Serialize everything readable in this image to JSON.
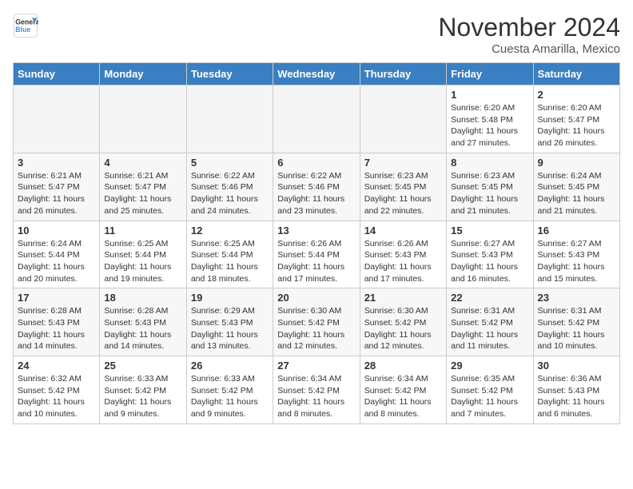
{
  "header": {
    "logo_general": "General",
    "logo_blue": "Blue",
    "month_title": "November 2024",
    "location": "Cuesta Amarilla, Mexico"
  },
  "weekdays": [
    "Sunday",
    "Monday",
    "Tuesday",
    "Wednesday",
    "Thursday",
    "Friday",
    "Saturday"
  ],
  "weeks": [
    [
      {
        "day": "",
        "info": ""
      },
      {
        "day": "",
        "info": ""
      },
      {
        "day": "",
        "info": ""
      },
      {
        "day": "",
        "info": ""
      },
      {
        "day": "",
        "info": ""
      },
      {
        "day": "1",
        "info": "Sunrise: 6:20 AM\nSunset: 5:48 PM\nDaylight: 11 hours and 27 minutes."
      },
      {
        "day": "2",
        "info": "Sunrise: 6:20 AM\nSunset: 5:47 PM\nDaylight: 11 hours and 26 minutes."
      }
    ],
    [
      {
        "day": "3",
        "info": "Sunrise: 6:21 AM\nSunset: 5:47 PM\nDaylight: 11 hours and 26 minutes."
      },
      {
        "day": "4",
        "info": "Sunrise: 6:21 AM\nSunset: 5:47 PM\nDaylight: 11 hours and 25 minutes."
      },
      {
        "day": "5",
        "info": "Sunrise: 6:22 AM\nSunset: 5:46 PM\nDaylight: 11 hours and 24 minutes."
      },
      {
        "day": "6",
        "info": "Sunrise: 6:22 AM\nSunset: 5:46 PM\nDaylight: 11 hours and 23 minutes."
      },
      {
        "day": "7",
        "info": "Sunrise: 6:23 AM\nSunset: 5:45 PM\nDaylight: 11 hours and 22 minutes."
      },
      {
        "day": "8",
        "info": "Sunrise: 6:23 AM\nSunset: 5:45 PM\nDaylight: 11 hours and 21 minutes."
      },
      {
        "day": "9",
        "info": "Sunrise: 6:24 AM\nSunset: 5:45 PM\nDaylight: 11 hours and 21 minutes."
      }
    ],
    [
      {
        "day": "10",
        "info": "Sunrise: 6:24 AM\nSunset: 5:44 PM\nDaylight: 11 hours and 20 minutes."
      },
      {
        "day": "11",
        "info": "Sunrise: 6:25 AM\nSunset: 5:44 PM\nDaylight: 11 hours and 19 minutes."
      },
      {
        "day": "12",
        "info": "Sunrise: 6:25 AM\nSunset: 5:44 PM\nDaylight: 11 hours and 18 minutes."
      },
      {
        "day": "13",
        "info": "Sunrise: 6:26 AM\nSunset: 5:44 PM\nDaylight: 11 hours and 17 minutes."
      },
      {
        "day": "14",
        "info": "Sunrise: 6:26 AM\nSunset: 5:43 PM\nDaylight: 11 hours and 17 minutes."
      },
      {
        "day": "15",
        "info": "Sunrise: 6:27 AM\nSunset: 5:43 PM\nDaylight: 11 hours and 16 minutes."
      },
      {
        "day": "16",
        "info": "Sunrise: 6:27 AM\nSunset: 5:43 PM\nDaylight: 11 hours and 15 minutes."
      }
    ],
    [
      {
        "day": "17",
        "info": "Sunrise: 6:28 AM\nSunset: 5:43 PM\nDaylight: 11 hours and 14 minutes."
      },
      {
        "day": "18",
        "info": "Sunrise: 6:28 AM\nSunset: 5:43 PM\nDaylight: 11 hours and 14 minutes."
      },
      {
        "day": "19",
        "info": "Sunrise: 6:29 AM\nSunset: 5:43 PM\nDaylight: 11 hours and 13 minutes."
      },
      {
        "day": "20",
        "info": "Sunrise: 6:30 AM\nSunset: 5:42 PM\nDaylight: 11 hours and 12 minutes."
      },
      {
        "day": "21",
        "info": "Sunrise: 6:30 AM\nSunset: 5:42 PM\nDaylight: 11 hours and 12 minutes."
      },
      {
        "day": "22",
        "info": "Sunrise: 6:31 AM\nSunset: 5:42 PM\nDaylight: 11 hours and 11 minutes."
      },
      {
        "day": "23",
        "info": "Sunrise: 6:31 AM\nSunset: 5:42 PM\nDaylight: 11 hours and 10 minutes."
      }
    ],
    [
      {
        "day": "24",
        "info": "Sunrise: 6:32 AM\nSunset: 5:42 PM\nDaylight: 11 hours and 10 minutes."
      },
      {
        "day": "25",
        "info": "Sunrise: 6:33 AM\nSunset: 5:42 PM\nDaylight: 11 hours and 9 minutes."
      },
      {
        "day": "26",
        "info": "Sunrise: 6:33 AM\nSunset: 5:42 PM\nDaylight: 11 hours and 9 minutes."
      },
      {
        "day": "27",
        "info": "Sunrise: 6:34 AM\nSunset: 5:42 PM\nDaylight: 11 hours and 8 minutes."
      },
      {
        "day": "28",
        "info": "Sunrise: 6:34 AM\nSunset: 5:42 PM\nDaylight: 11 hours and 8 minutes."
      },
      {
        "day": "29",
        "info": "Sunrise: 6:35 AM\nSunset: 5:42 PM\nDaylight: 11 hours and 7 minutes."
      },
      {
        "day": "30",
        "info": "Sunrise: 6:36 AM\nSunset: 5:43 PM\nDaylight: 11 hours and 6 minutes."
      }
    ]
  ]
}
